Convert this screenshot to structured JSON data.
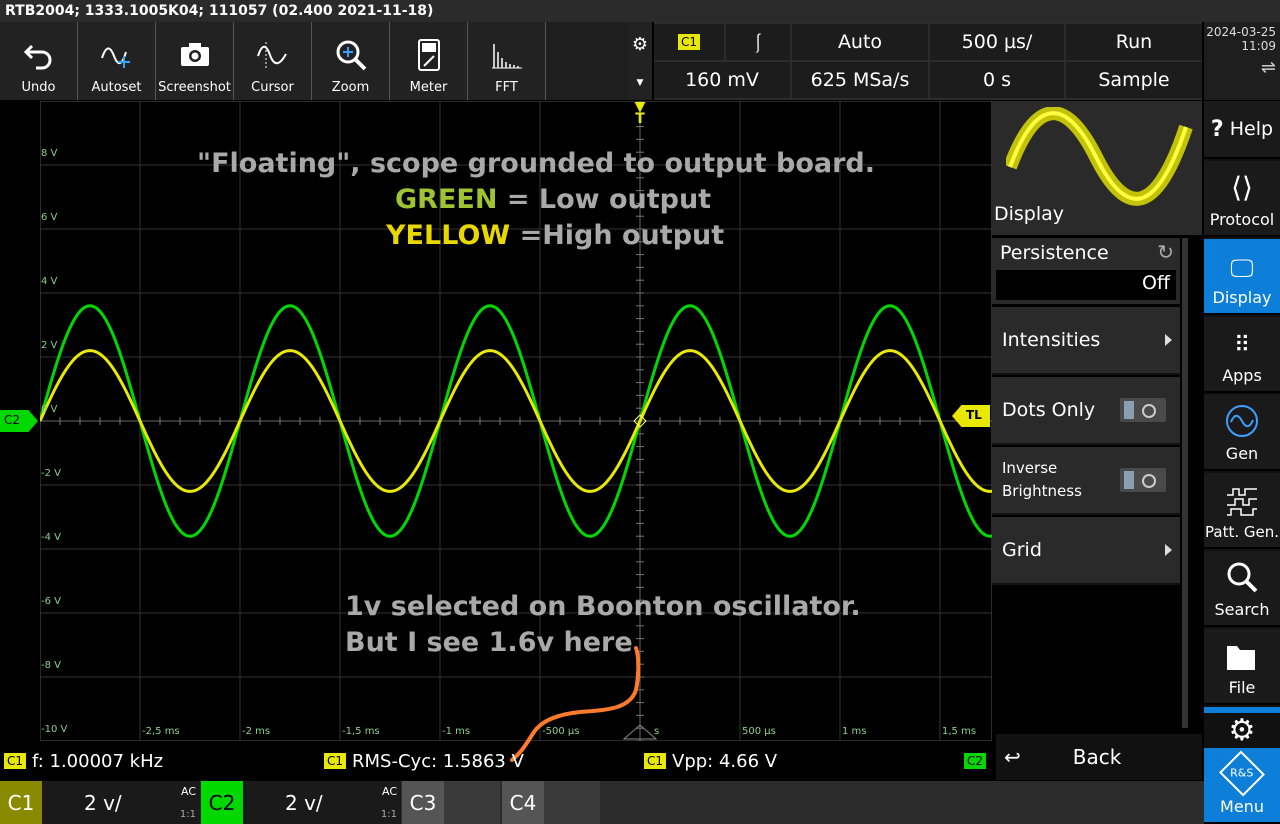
{
  "titlebar": {
    "text": "RTB2004; 1333.1005K04; 111057 (02.400 2021-11-18)"
  },
  "toolbar": {
    "undo": "Undo",
    "autoset": "Autoset",
    "screenshot": "Screenshot",
    "cursor": "Cursor",
    "zoom": "Zoom",
    "meter": "Meter",
    "fft": "FFT"
  },
  "trigger": {
    "source": "C1",
    "mode": "Auto",
    "timebase": "500 µs/",
    "run": "Run",
    "level": "160 mV",
    "samplerate": "625 MSa/s",
    "offset": "0 s",
    "acq": "Sample"
  },
  "datetime": {
    "date": "2024-03-25",
    "time": "11:09"
  },
  "ylabels": [
    "8 V",
    "6 V",
    "4 V",
    "2 V",
    "0 V",
    "-2 V",
    "-4 V",
    "-6 V",
    "-8 V",
    "-10 V"
  ],
  "xlabels": [
    "-2,5 ms",
    "-2 ms",
    "-1,5 ms",
    "-1 ms",
    "-500 µs",
    "s",
    "500 µs",
    "1 ms",
    "1,5 ms"
  ],
  "annotation": {
    "line1": "\"Floating\", scope grounded to output board.",
    "green": "GREEN",
    "green_rest": " = Low output",
    "yellow": "YELLOW",
    "yellow_rest": " =High output",
    "bottom1": "1v selected on Boonton oscillator.",
    "bottom2": "But I see 1.6v here"
  },
  "markers": {
    "c2": "C2",
    "tl": "TL",
    "t": "T"
  },
  "measurements": {
    "c1": "C1",
    "c2": "C2",
    "freq": "f: 1.00007 kHz",
    "rms": "RMS-Cyc: 1.5863 V",
    "vpp": "Vpp: 4.66 V"
  },
  "display_panel": {
    "title": "Display",
    "persistence": "Persistence",
    "persistence_value": "Off",
    "intensities": "Intensities",
    "dots_only": "Dots Only",
    "inverse1": "Inverse",
    "inverse2": "Brightness",
    "grid": "Grid",
    "back": "Back"
  },
  "sidebar": {
    "help": "Help",
    "protocol": "Protocol",
    "display": "Display",
    "apps": "Apps",
    "gen": "Gen",
    "patt": "Patt. Gen.",
    "search": "Search",
    "file": "File",
    "menu": "Menu"
  },
  "channels": {
    "c1": "C1",
    "c1_scale": "2 v/",
    "c1_cpl": "AC",
    "c1_ratio": "1:1",
    "c2": "C2",
    "c2_scale": "2 v/",
    "c2_cpl": "AC",
    "c2_ratio": "1:1",
    "c3": "C3",
    "c4": "C4"
  },
  "colors": {
    "c1": "#e8e800",
    "c2": "#00d800",
    "highlight": "#0d7fd8",
    "annotation_orange": "#ff7a2a"
  }
}
